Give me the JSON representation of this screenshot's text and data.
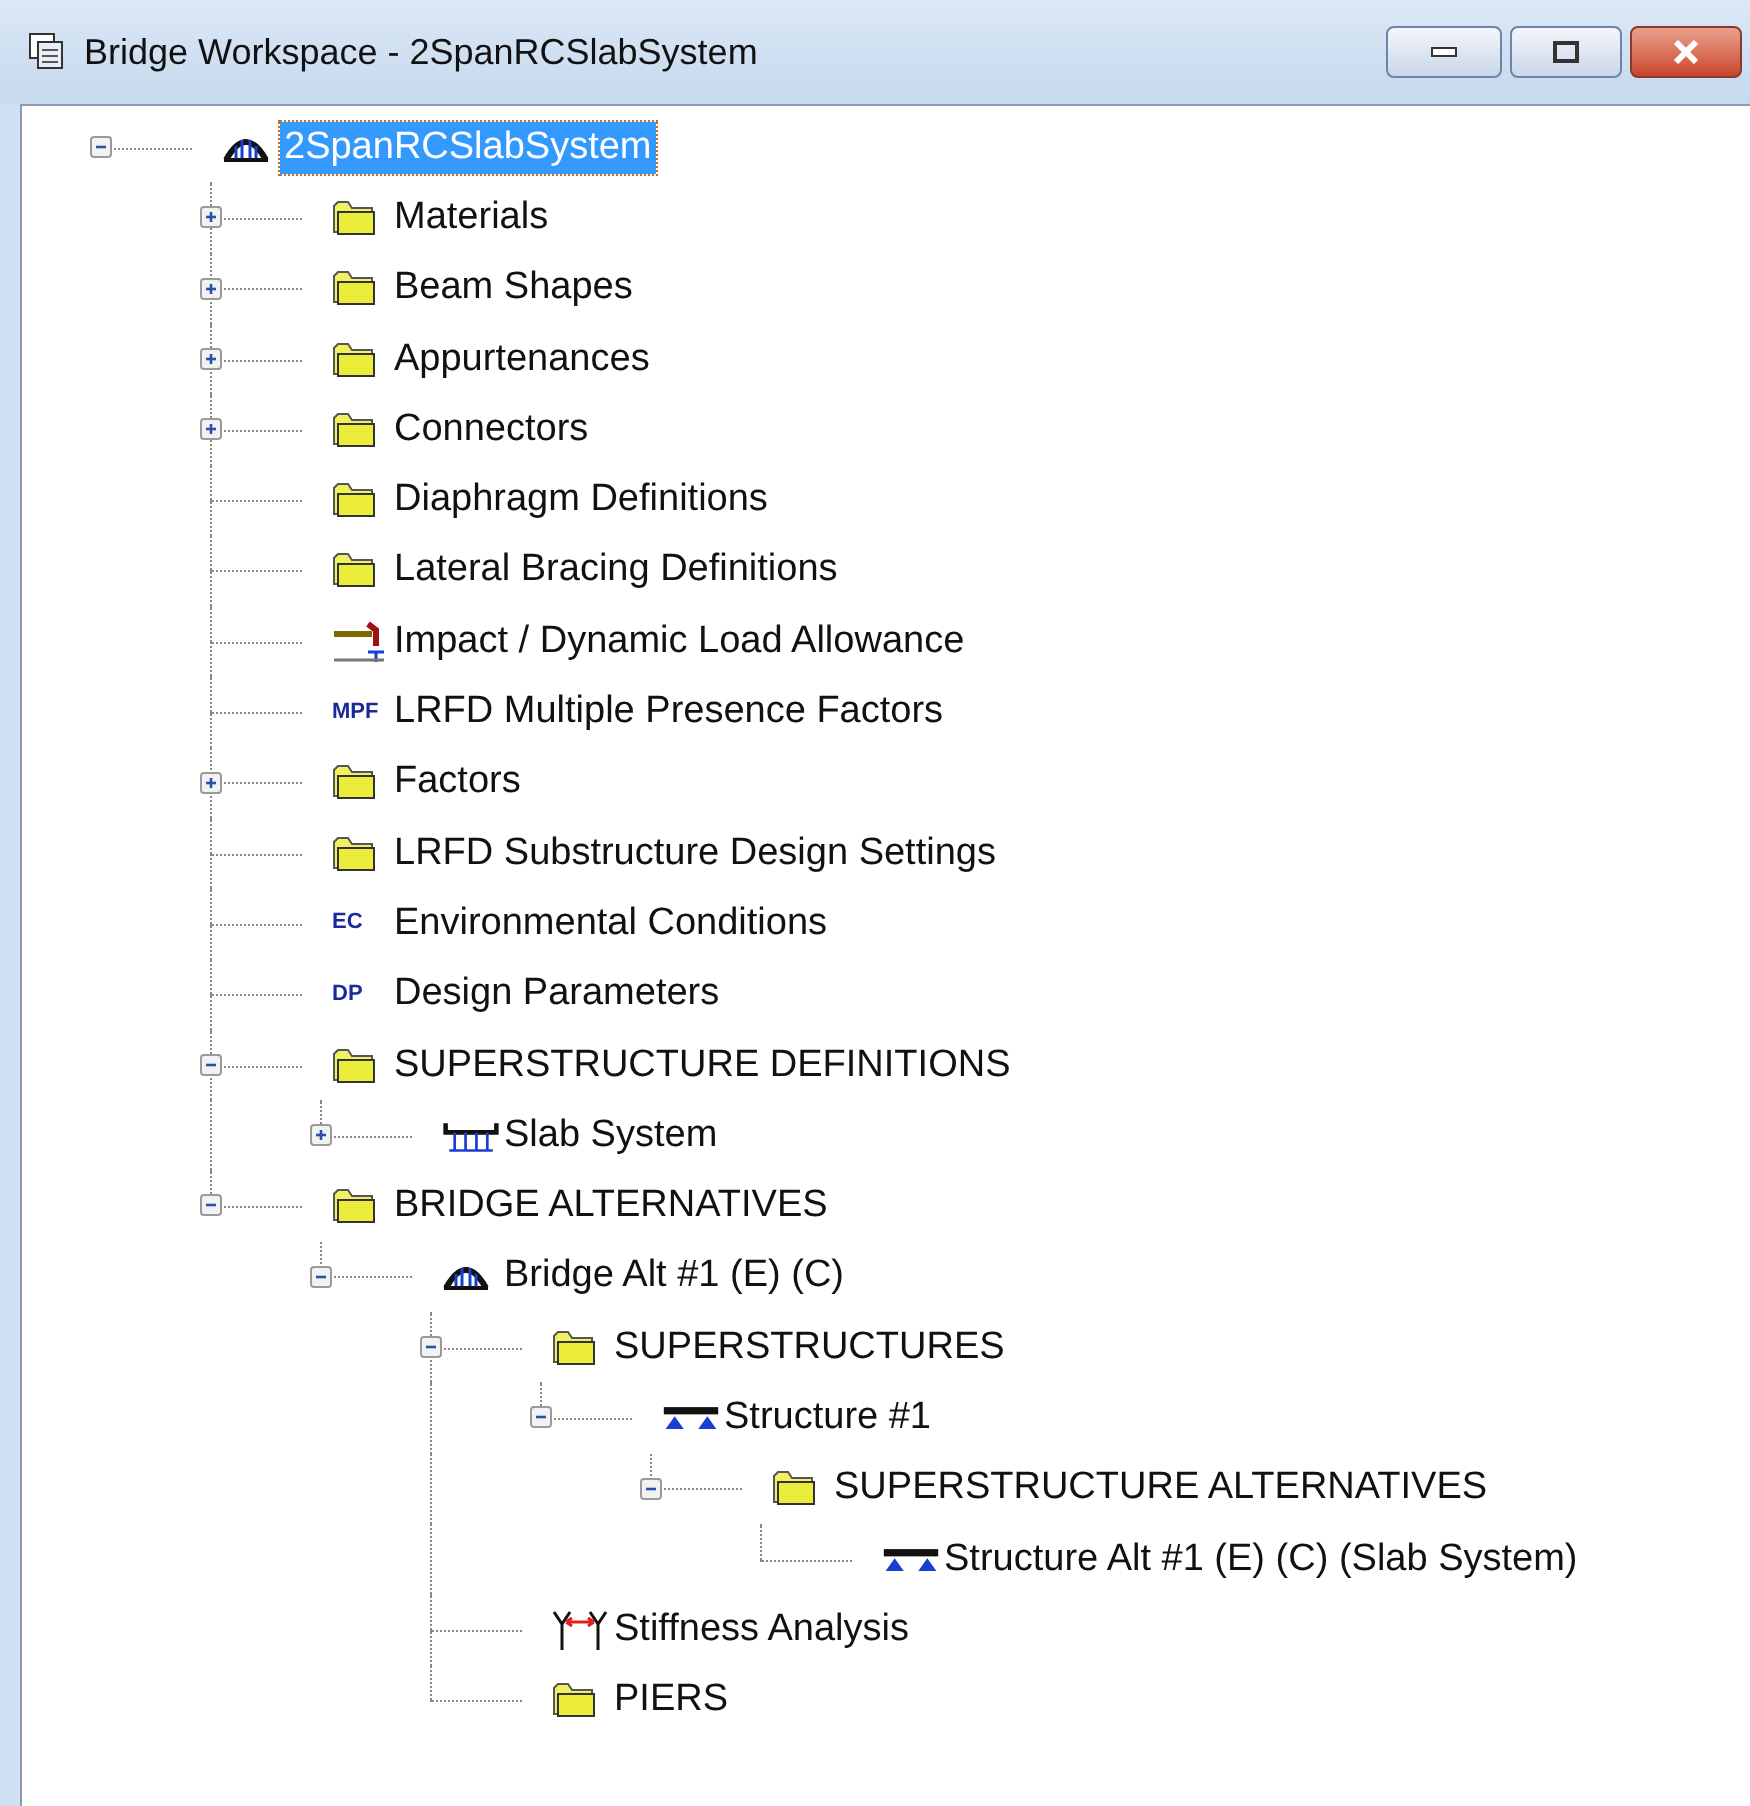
{
  "window": {
    "title": "Bridge Workspace - 2SpanRCSlabSystem"
  },
  "tree": [
    {
      "label": "2SpanRCSlabSystem",
      "kind": "bridge",
      "selected": true,
      "expanded": true,
      "children": [
        {
          "label": "Materials",
          "kind": "folder",
          "selected": false,
          "expanded": false
        },
        {
          "label": "Beam Shapes",
          "kind": "folder",
          "selected": false,
          "expanded": false
        },
        {
          "label": "Appurtenances",
          "kind": "folder",
          "selected": false,
          "expanded": false
        },
        {
          "label": "Connectors",
          "kind": "folder",
          "selected": false,
          "expanded": false
        },
        {
          "label": "Diaphragm Definitions",
          "kind": "folder",
          "selected": false
        },
        {
          "label": "Lateral Bracing Definitions",
          "kind": "folder",
          "selected": false
        },
        {
          "label": "Impact / Dynamic Load Allowance",
          "kind": "load",
          "selected": false
        },
        {
          "label": "LRFD Multiple Presence Factors",
          "kind": "letters",
          "icon_text": "MPF",
          "selected": false
        },
        {
          "label": "Factors",
          "kind": "folder",
          "selected": false,
          "expanded": false
        },
        {
          "label": "LRFD Substructure Design Settings",
          "kind": "folder",
          "selected": false
        },
        {
          "label": "Environmental Conditions",
          "kind": "letters",
          "icon_text": "EC",
          "selected": false
        },
        {
          "label": "Design Parameters",
          "kind": "letters",
          "icon_text": "DP",
          "selected": false
        },
        {
          "label": "SUPERSTRUCTURE DEFINITIONS",
          "kind": "folder",
          "selected": false,
          "expanded": true,
          "children": [
            {
              "label": "Slab System",
              "kind": "slab",
              "selected": false,
              "expanded": false
            }
          ]
        },
        {
          "label": "BRIDGE ALTERNATIVES",
          "kind": "folder",
          "selected": false,
          "expanded": true,
          "children": [
            {
              "label": "Bridge Alt #1 (E) (C)",
              "kind": "bridge",
              "selected": false,
              "expanded": true,
              "children": [
                {
                  "label": "SUPERSTRUCTURES",
                  "kind": "folder",
                  "selected": false,
                  "expanded": true,
                  "children": [
                    {
                      "label": "Structure #1",
                      "kind": "girder",
                      "selected": false,
                      "expanded": true,
                      "children": [
                        {
                          "label": "SUPERSTRUCTURE ALTERNATIVES",
                          "kind": "folder",
                          "selected": false,
                          "expanded": true,
                          "children": [
                            {
                              "label": "Structure Alt #1 (E) (C) (Slab System)",
                              "kind": "girder",
                              "selected": false
                            }
                          ]
                        }
                      ]
                    }
                  ]
                },
                {
                  "label": "Stiffness Analysis",
                  "kind": "stiffness",
                  "selected": false
                },
                {
                  "label": "PIERS",
                  "kind": "folder",
                  "selected": false
                }
              ]
            }
          ]
        }
      ]
    }
  ]
}
